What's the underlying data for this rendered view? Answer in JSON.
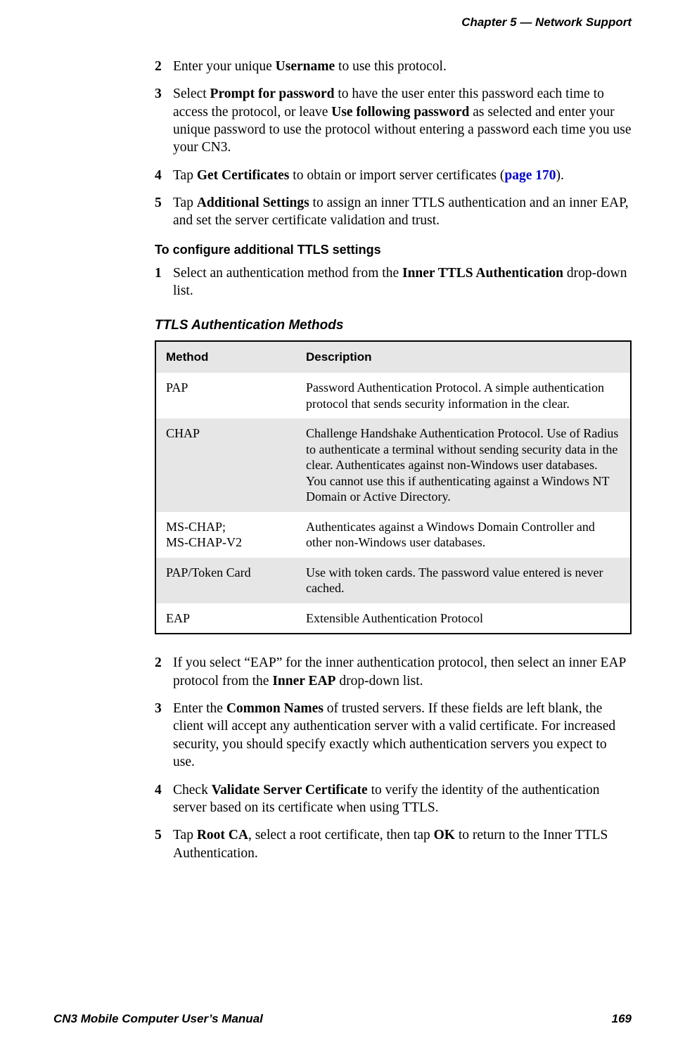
{
  "header": {
    "chapter": "Chapter 5 —  Network Support"
  },
  "steps_a": [
    {
      "num": "2",
      "html": "Enter your unique <b>Username</b> to use this protocol."
    },
    {
      "num": "3",
      "html": "Select <b>Prompt for password</b> to have the user enter this password each time to access the protocol, or leave <b>Use following password</b> as selected and enter your unique password to use the protocol without entering a password each time you use your CN3."
    },
    {
      "num": "4",
      "html": "Tap <b>Get Certificates</b> to obtain or import server certificates (<span class='link'>page 170</span>)."
    },
    {
      "num": "5",
      "html": "Tap <b>Additional Settings</b> to assign an inner TTLS authentication and an inner EAP, and set the server certificate validation and trust."
    }
  ],
  "sub_heading": "To configure additional TTLS settings",
  "steps_b": [
    {
      "num": "1",
      "html": "Select an authentication method from the <b>Inner TTLS Authentication</b> drop-down list."
    }
  ],
  "table_caption": "TTLS Authentication Methods",
  "table": {
    "headers": [
      "Method",
      "Description"
    ],
    "rows": [
      {
        "method": "PAP",
        "desc": "Password Authentication Protocol. A simple authentication protocol that sends security information in the clear.",
        "shaded": false
      },
      {
        "method": "CHAP",
        "desc": "Challenge Handshake Authentication Protocol. Use of Radius to authenticate a terminal without sending security data in the clear. Authenticates against non-Windows user databases. You cannot use this if authenticating against a Windows NT Domain or Active Directory.",
        "shaded": true
      },
      {
        "method": "MS-CHAP;\nMS-CHAP-V2",
        "desc": "Authenticates against a Windows Domain Controller and other non-Windows user databases.",
        "shaded": false
      },
      {
        "method": "PAP/Token Card",
        "desc": "Use with token cards. The password value entered is never cached.",
        "shaded": true
      },
      {
        "method": "EAP",
        "desc": "Extensible Authentication Protocol",
        "shaded": false
      }
    ]
  },
  "steps_c": [
    {
      "num": "2",
      "html": "If you select “EAP” for the inner authentication protocol, then select an inner EAP protocol from the <b>Inner EAP</b> drop-down list."
    },
    {
      "num": "3",
      "html": "Enter the <b>Common Names</b> of trusted servers. If these fields are left blank, the client will accept any authentication server with a valid certificate. For increased security, you should specify exactly which authentication servers you expect to use."
    },
    {
      "num": "4",
      "html": "Check <b>Validate Server Certificate</b> to verify the identity of the authentication server based on its certificate when using TTLS."
    },
    {
      "num": "5",
      "html": "Tap <b>Root CA</b>, select a root certificate, then tap <b>OK</b> to return to the Inner TTLS Authentication."
    }
  ],
  "footer": {
    "left": "CN3 Mobile Computer User’s Manual",
    "right": "169"
  }
}
